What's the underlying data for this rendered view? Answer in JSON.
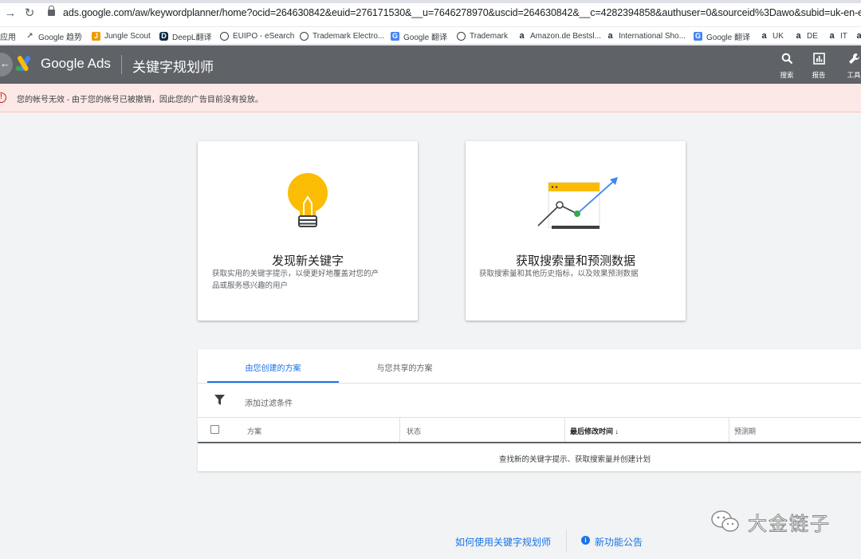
{
  "browser": {
    "url": "ads.google.com/aw/keywordplanner/home?ocid=264630842&euid=276171530&__u=7646278970&uscid=264630842&__c=4282394858&authuser=0&sourceid%3Dawo&subid=uk-en-et-g-aw-a-tool",
    "bookmarks": [
      "应用",
      "Google 趋势",
      "Jungle Scout",
      "DeepL翻译",
      "EUIPO - eSearch",
      "Trademark Electro...",
      "Google 翻译",
      "Trademark",
      "Amazon.de Bestsl...",
      "International Sho...",
      "Google 翻译",
      "UK",
      "DE",
      "IT"
    ]
  },
  "header": {
    "brand": "Google Ads",
    "page_title": "关键字规划师",
    "tools": [
      "搜索",
      "报告",
      "工具"
    ]
  },
  "alert": {
    "text": "您的帐号无效 - 由于您的帐号已被撤销，因此您的广告目前没有投放。"
  },
  "cards": [
    {
      "title": "发现新关键字",
      "desc_line1": "获取实用的关键字提示，以便更好地覆盖对您的产",
      "desc_line2": "品或服务感兴趣的用户"
    },
    {
      "title": "获取搜索量和预测数据",
      "desc_line1": "获取搜索量和其他历史指标，以及效果预测数据"
    }
  ],
  "plans": {
    "tabs": [
      "由您创建的方案",
      "与您共享的方案"
    ],
    "filter_label": "添加过滤条件",
    "columns": [
      "方案",
      "状态",
      "最后修改时间",
      "预测期"
    ],
    "sort_arrow": "↓",
    "empty_message": "查找新的关键字提示、获取搜索量并创建计划"
  },
  "footer": {
    "how_to": "如何使用关键字规划师",
    "whats_new": "新功能公告"
  },
  "watermark": {
    "text": "大金链子"
  },
  "colors": {
    "header_bg": "#5f6368",
    "alert_bg": "#fce8e6",
    "accent": "#1a73e8",
    "bulb": "#fbbc04",
    "chart_green": "#34a853"
  }
}
